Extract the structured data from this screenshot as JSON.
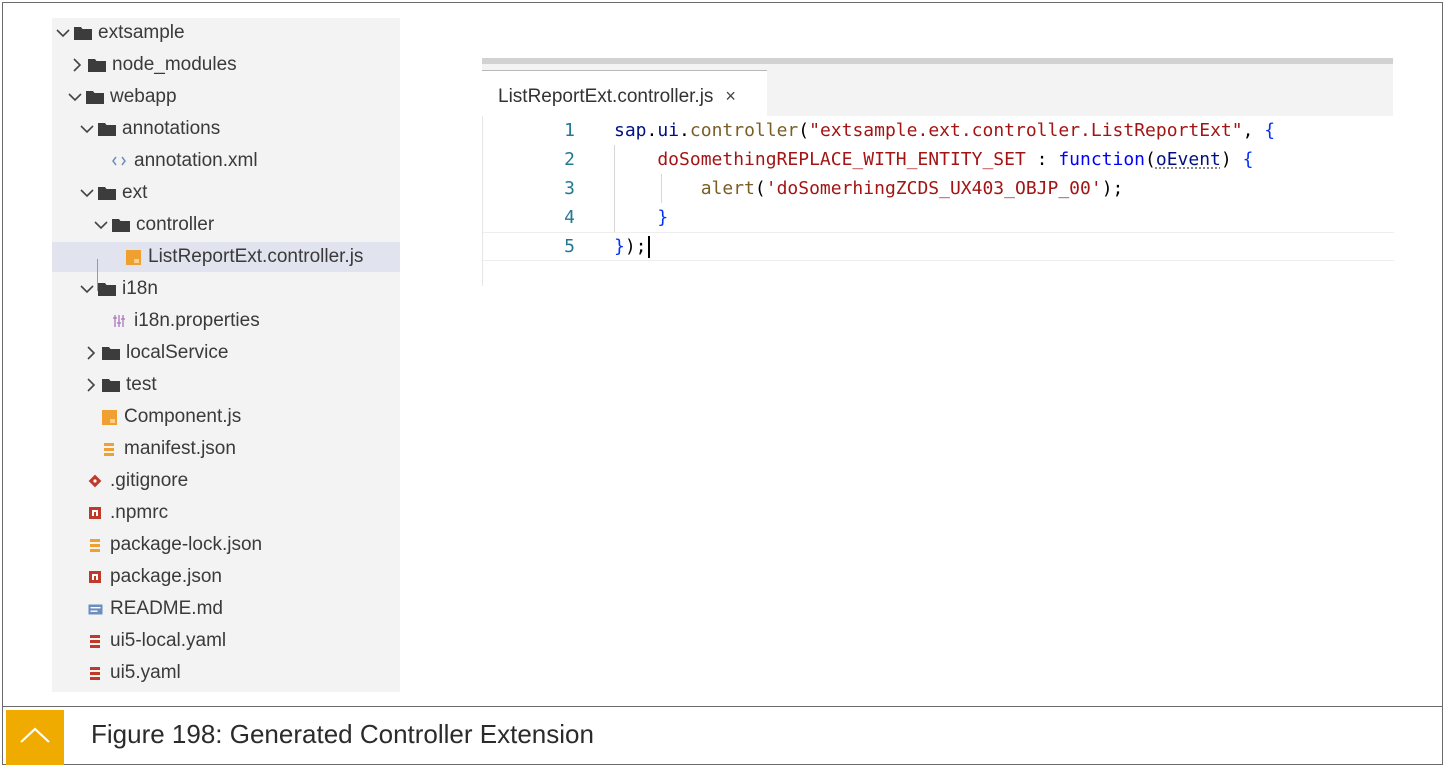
{
  "explorer": {
    "items": [
      {
        "label": "extsample",
        "icon": "folder-icon",
        "chevron": "chevron-down-icon"
      },
      {
        "label": "node_modules",
        "icon": "folder-icon",
        "chevron": "chevron-right-icon"
      },
      {
        "label": "webapp",
        "icon": "folder-icon",
        "chevron": "chevron-down-icon"
      },
      {
        "label": "annotations",
        "icon": "folder-icon",
        "chevron": "chevron-down-icon"
      },
      {
        "label": "annotation.xml",
        "icon": "xml-file-icon"
      },
      {
        "label": "ext",
        "icon": "folder-icon",
        "chevron": "chevron-down-icon"
      },
      {
        "label": "controller",
        "icon": "folder-icon",
        "chevron": "chevron-down-icon"
      },
      {
        "label": "ListReportExt.controller.js",
        "icon": "js-file-icon",
        "selected": true
      },
      {
        "label": "i18n",
        "icon": "folder-icon",
        "chevron": "chevron-down-icon"
      },
      {
        "label": "i18n.properties",
        "icon": "properties-file-icon"
      },
      {
        "label": "localService",
        "icon": "folder-icon",
        "chevron": "chevron-right-icon"
      },
      {
        "label": "test",
        "icon": "folder-icon",
        "chevron": "chevron-right-icon"
      },
      {
        "label": "Component.js",
        "icon": "js-file-icon"
      },
      {
        "label": "manifest.json",
        "icon": "json-file-icon"
      },
      {
        "label": ".gitignore",
        "icon": "git-file-icon"
      },
      {
        "label": ".npmrc",
        "icon": "npm-file-icon"
      },
      {
        "label": "package-lock.json",
        "icon": "json-file-icon"
      },
      {
        "label": "package.json",
        "icon": "npm-file-icon"
      },
      {
        "label": "README.md",
        "icon": "markdown-file-icon"
      },
      {
        "label": "ui5-local.yaml",
        "icon": "yaml-file-icon"
      },
      {
        "label": "ui5.yaml",
        "icon": "yaml-file-icon"
      }
    ]
  },
  "editor": {
    "tab": {
      "label": "ListReportExt.controller.js",
      "close": "×"
    },
    "lines": [
      {
        "num": "1",
        "tokens": [
          {
            "t": "sap",
            "c": "default"
          },
          {
            "t": ".",
            "c": "punct"
          },
          {
            "t": "ui",
            "c": "default"
          },
          {
            "t": ".",
            "c": "punct"
          },
          {
            "t": "controller",
            "c": "fn"
          },
          {
            "t": "(",
            "c": "punct"
          },
          {
            "t": "\"extsample.ext.controller.ListReportExt\"",
            "c": "str"
          },
          {
            "t": ", ",
            "c": "punct"
          },
          {
            "t": "{",
            "c": "brace"
          }
        ]
      },
      {
        "num": "2",
        "tokens": [
          {
            "t": "    doSomethingREPLACE_WITH_ENTITY_SET",
            "c": "str"
          },
          {
            "t": " : ",
            "c": "punct"
          },
          {
            "t": "function",
            "c": "kw"
          },
          {
            "t": "(",
            "c": "punct"
          },
          {
            "t": "oEvent",
            "c": "param"
          },
          {
            "t": ") ",
            "c": "punct"
          },
          {
            "t": "{",
            "c": "brace"
          }
        ]
      },
      {
        "num": "3",
        "tokens": [
          {
            "t": "        alert",
            "c": "fn"
          },
          {
            "t": "(",
            "c": "punct"
          },
          {
            "t": "'doSomerhingZCDS_UX403_OBJP_00'",
            "c": "str"
          },
          {
            "t": ");",
            "c": "punct"
          }
        ]
      },
      {
        "num": "4",
        "tokens": [
          {
            "t": "    }",
            "c": "brace"
          }
        ]
      },
      {
        "num": "5",
        "tokens": [
          {
            "t": "}",
            "c": "brace"
          },
          {
            "t": ");",
            "c": "punct"
          }
        ]
      }
    ]
  },
  "caption": {
    "text": "Figure 198: Generated Controller Extension",
    "icon": "chevron-up-icon",
    "accent": "#f0ab00"
  }
}
